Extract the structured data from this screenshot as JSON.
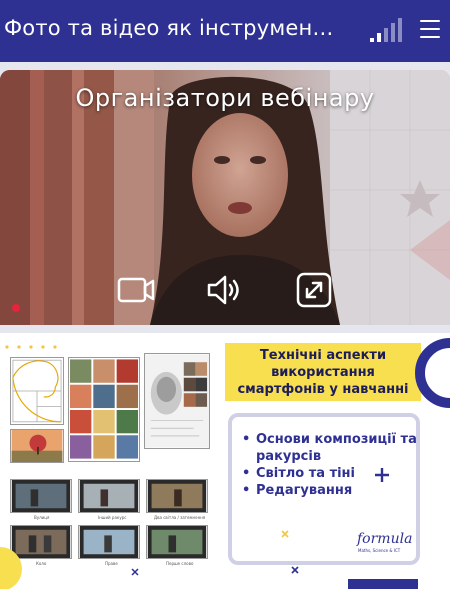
{
  "header": {
    "title": "Фото та відео як інструмен…",
    "signal_icon": "signal-strength-icon",
    "menu_icon": "hamburger-menu-icon",
    "color": "#2f3192"
  },
  "video": {
    "caption": "Організатори вебінару",
    "controls": [
      "camera-icon",
      "speaker-icon",
      "fullscreen-icon"
    ],
    "recording_color": "#e8233b"
  },
  "slide": {
    "tech_title": "Технічні аспекти використання смартфонів у навчанні",
    "bullets": [
      "Основи композиції та ракурсів",
      "Світло та тіні",
      "Редагування"
    ],
    "logo": "formula",
    "logo_sub": "Maths, Science & ICT",
    "video_captions": [
      "Вулиця",
      "Інший ракурс",
      "Два світла / затемнення",
      "Коло",
      "Праве",
      "Перше слово"
    ],
    "accent_yellow": "#f8df50",
    "accent_navy": "#2f3192"
  }
}
